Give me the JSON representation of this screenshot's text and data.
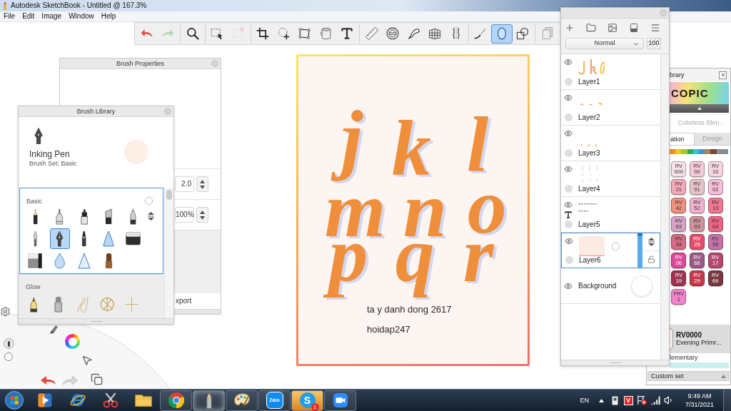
{
  "window": {
    "title": "Autodesk SketchBook - Untitled @ 167.3%"
  },
  "menu": [
    {
      "label": "File"
    },
    {
      "label": "Edit"
    },
    {
      "label": "Image"
    },
    {
      "label": "Window"
    },
    {
      "label": "Help"
    }
  ],
  "toolbar": {
    "groups": [
      [
        {
          "kind": "undo",
          "selected": false,
          "disabled": false
        },
        {
          "kind": "redo",
          "selected": false,
          "disabled": true
        }
      ],
      [
        {
          "kind": "zoom",
          "selected": false,
          "disabled": false
        }
      ],
      [
        {
          "kind": "select",
          "selected": false,
          "disabled": false
        },
        {
          "kind": "select-clear",
          "selected": false,
          "disabled": true
        }
      ],
      [
        {
          "kind": "crop",
          "selected": false,
          "disabled": false
        },
        {
          "kind": "transform",
          "selected": false,
          "disabled": false
        },
        {
          "kind": "distort",
          "selected": false,
          "disabled": false
        },
        {
          "kind": "fill",
          "selected": false,
          "disabled": false
        },
        {
          "kind": "text",
          "selected": false,
          "disabled": false
        }
      ],
      [
        {
          "kind": "ruler",
          "selected": false,
          "disabled": false
        },
        {
          "kind": "ellipse-guide",
          "selected": false,
          "disabled": false
        },
        {
          "kind": "french-curve",
          "selected": false,
          "disabled": false
        },
        {
          "kind": "perspective",
          "selected": false,
          "disabled": false
        },
        {
          "kind": "symmetry",
          "selected": false,
          "disabled": false
        }
      ],
      [
        {
          "kind": "stroke",
          "selected": false,
          "disabled": false
        },
        {
          "kind": "ellipse",
          "selected": true,
          "disabled": false
        },
        {
          "kind": "shapes",
          "selected": false,
          "disabled": false
        }
      ],
      [
        {
          "kind": "pages",
          "selected": false,
          "disabled": false
        }
      ]
    ]
  },
  "brush_properties": {
    "title": "Brush Properties",
    "fields": [
      {
        "value": "2.0"
      },
      {
        "value": "100%"
      }
    ],
    "footer": "xport"
  },
  "brush_library": {
    "title": "Brush Library",
    "current": {
      "name": "Inking Pen",
      "set": "Brush Set: Basic"
    },
    "sets": [
      {
        "name": "Basic",
        "selected": true,
        "brushes": [
          {
            "kind": "pencil",
            "selected": false
          },
          {
            "kind": "technical-pen",
            "selected": false
          },
          {
            "kind": "marker",
            "selected": false
          },
          {
            "kind": "chisel-marker",
            "selected": false
          },
          {
            "kind": "ballpoint",
            "selected": false
          },
          {
            "kind": "paintbrush",
            "selected": false
          },
          {
            "kind": "inking-pen",
            "selected": true
          },
          {
            "kind": "felt-pen",
            "selected": false
          },
          {
            "kind": "airbrush",
            "selected": false
          },
          {
            "kind": "hard-eraser",
            "selected": false
          },
          {
            "kind": "soft-eraser",
            "selected": false
          },
          {
            "kind": "drop",
            "selected": false
          },
          {
            "kind": "triangle",
            "selected": false
          },
          {
            "kind": "stamp",
            "selected": false
          }
        ]
      },
      {
        "name": "Glow",
        "selected": false,
        "brushes": [
          {
            "kind": "glow-pen",
            "selected": false
          },
          {
            "kind": "glow-marker",
            "selected": false
          },
          {
            "kind": "scribble",
            "selected": false
          },
          {
            "kind": "burst",
            "selected": false
          },
          {
            "kind": "sparkle",
            "selected": false
          }
        ]
      }
    ]
  },
  "lagoon": {
    "items": [
      {
        "kind": "settings"
      },
      {
        "kind": "pen"
      },
      {
        "kind": "brush"
      },
      {
        "kind": "color"
      },
      {
        "kind": "dot"
      },
      {
        "kind": "pointer"
      },
      {
        "kind": "undo"
      },
      {
        "kind": "redo"
      },
      {
        "kind": "pages"
      }
    ]
  },
  "canvas": {
    "letters": [
      "j",
      "k",
      "l",
      "m",
      "n",
      "o",
      "p",
      "q",
      "r"
    ],
    "lines": [
      "ta y danh dong 2617",
      "hoidap247"
    ]
  },
  "layers": {
    "blend_mode": "Normal",
    "opacity": "100",
    "layers": [
      {
        "name": "Layer1",
        "kind": "paint",
        "thumbnail": {
          "kind": "letters"
        },
        "visible": true,
        "selected": false
      },
      {
        "name": "Layer2",
        "kind": "paint",
        "thumbnail": {
          "kind": "marks"
        },
        "visible": true,
        "selected": false
      },
      {
        "name": "Layer3",
        "kind": "paint",
        "thumbnail": {
          "kind": "marks-low"
        },
        "visible": true,
        "selected": false
      },
      {
        "name": "Layer4",
        "kind": "paint",
        "thumbnail": {
          "kind": "sketch"
        },
        "visible": true,
        "selected": false
      },
      {
        "name": "Layer5",
        "kind": "text",
        "thumbnail": {
          "kind": "text"
        },
        "visible": true,
        "selected": false
      },
      {
        "name": "Layer6",
        "kind": "paint",
        "thumbnail": {
          "kind": "fill"
        },
        "visible": true,
        "selected": true
      },
      {
        "name": "Background",
        "kind": "background",
        "visible": true,
        "selected": false
      }
    ]
  },
  "color_library": {
    "title": "brary",
    "logo": "COPIC",
    "set_name": "Colorless Blen..",
    "tabs": [
      {
        "label": "ation",
        "selected": true
      },
      {
        "label": "Design",
        "selected": false
      }
    ],
    "hues": [
      {
        "color": "#f28a2e"
      },
      {
        "color": "#f5c518"
      },
      {
        "color": "#a8c43a"
      },
      {
        "color": "#3aa852"
      },
      {
        "color": "#34c4d2"
      },
      {
        "color": "#4a8fcc"
      },
      {
        "color": "#a8845c"
      },
      {
        "color": "#6e4a3a"
      },
      {
        "color": "#8e8e8e"
      },
      {
        "color": "#7a8e9e"
      }
    ],
    "swatches": [
      {
        "family": "RV",
        "number": "000",
        "color": "#f7e2e8"
      },
      {
        "family": "RV",
        "number": "00",
        "color": "#f2cad8"
      },
      {
        "family": "RV",
        "number": "10",
        "color": "#f6d6e2"
      },
      {
        "family": "RV",
        "number": "21",
        "color": "#f2a9ba"
      },
      {
        "family": "RV",
        "number": "91",
        "color": "#e6c2ca"
      },
      {
        "family": "RV",
        "number": "02",
        "color": "#f5bfd8"
      },
      {
        "family": "RV",
        "number": "42",
        "color": "#ef917e"
      },
      {
        "family": "RV",
        "number": "52",
        "color": "#eeb2cf"
      },
      {
        "family": "RV",
        "number": "13",
        "color": "#ee7893"
      },
      {
        "family": "RV",
        "number": "63",
        "color": "#d8a2c8"
      },
      {
        "family": "RV",
        "number": "93",
        "color": "#cf939c"
      },
      {
        "family": "RV",
        "number": "04",
        "color": "#ee6584"
      },
      {
        "family": "RV",
        "number": "34",
        "color": "#d36c84"
      },
      {
        "family": "RV",
        "number": "25",
        "color": "#e44c6c"
      },
      {
        "family": "RV",
        "number": "55",
        "color": "#c673aa"
      },
      {
        "family": "RV",
        "number": "06",
        "color": "#dc4a98"
      },
      {
        "family": "RV",
        "number": "66",
        "color": "#9c5a88"
      },
      {
        "family": "RV",
        "number": "17",
        "color": "#b44a72"
      },
      {
        "family": "RV",
        "number": "19",
        "color": "#9c3452"
      },
      {
        "family": "RV",
        "number": "29",
        "color": "#c43a4a"
      },
      {
        "family": "RV",
        "number": "69",
        "color": "#773a40"
      },
      {
        "family": "FRV",
        "number": "1",
        "color": "#f184cc"
      }
    ],
    "current": {
      "code": "RV0000",
      "name": "Evening Primr...",
      "scheme": "lementary"
    },
    "custom_set": "Custom set"
  },
  "taskbar": {
    "apps": [
      {
        "kind": "media-player",
        "open": false,
        "active": false,
        "attention": false
      },
      {
        "kind": "internet-explorer",
        "open": false,
        "active": false,
        "attention": false
      },
      {
        "kind": "snipping-tool",
        "open": false,
        "active": false,
        "attention": false
      },
      {
        "kind": "file-explorer",
        "open": false,
        "active": false,
        "attention": false
      },
      {
        "kind": "chrome",
        "open": true,
        "active": false,
        "attention": false
      },
      {
        "kind": "sketchbook",
        "open": true,
        "active": true,
        "attention": false
      },
      {
        "kind": "paint",
        "open": true,
        "active": false,
        "attention": false
      },
      {
        "kind": "zalo",
        "open": true,
        "active": false,
        "attention": false,
        "label": "Zalo"
      },
      {
        "kind": "skype",
        "open": true,
        "active": false,
        "attention": true,
        "label": "S",
        "badge": "1"
      },
      {
        "kind": "zoom",
        "open": true,
        "active": false,
        "attention": false
      }
    ],
    "tray": {
      "language": "EN",
      "icons": [
        {
          "kind": "show-hidden"
        },
        {
          "kind": "device"
        },
        {
          "kind": "antivirus",
          "label": "V"
        },
        {
          "kind": "network-error"
        },
        {
          "kind": "signal"
        },
        {
          "kind": "volume"
        }
      ],
      "time": "9:49 AM",
      "date": "7/31/2021"
    }
  }
}
